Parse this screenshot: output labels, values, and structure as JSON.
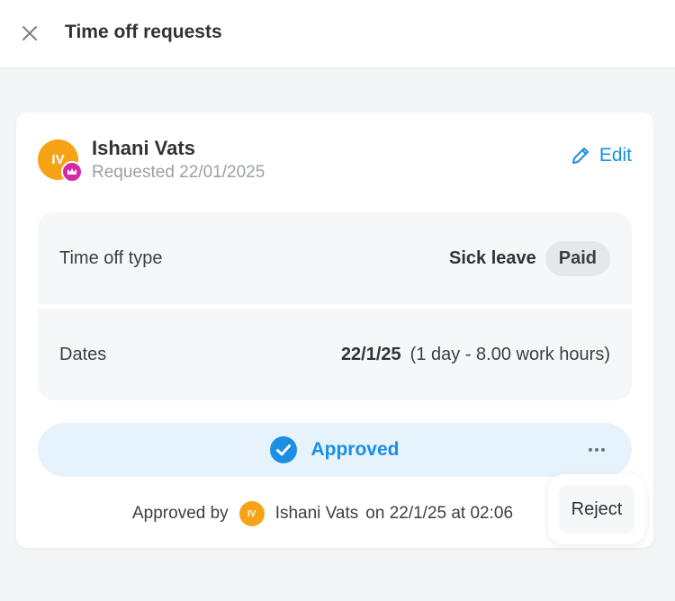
{
  "header": {
    "title": "Time off requests",
    "close_icon": "close-icon"
  },
  "request": {
    "avatar_initials": "IV",
    "badge_icon": "crown-icon",
    "user_name": "Ishani Vats",
    "requested_text": "Requested 22/01/2025",
    "edit_label": "Edit",
    "edit_icon": "pencil-icon"
  },
  "details": {
    "type_label": "Time off type",
    "type_value": "Sick leave",
    "type_badge": "Paid",
    "dates_label": "Dates",
    "dates_value": "22/1/25",
    "dates_extra": "(1 day - 8.00 work hours)"
  },
  "status": {
    "label": "Approved",
    "icon": "check-circle-icon",
    "more_icon": "more-horizontal-icon",
    "color": "#1a8fe3",
    "background": "#e6f3fd"
  },
  "approval": {
    "prefix": "Approved by",
    "avatar_initials": "IV",
    "approver": "Ishani Vats",
    "when": "on 22/1/25 at 02:06"
  },
  "menu": {
    "reject_label": "Reject"
  },
  "colors": {
    "accent": "#1a8fe3",
    "avatar": "#f6a316",
    "badge": "#d32aa6"
  }
}
